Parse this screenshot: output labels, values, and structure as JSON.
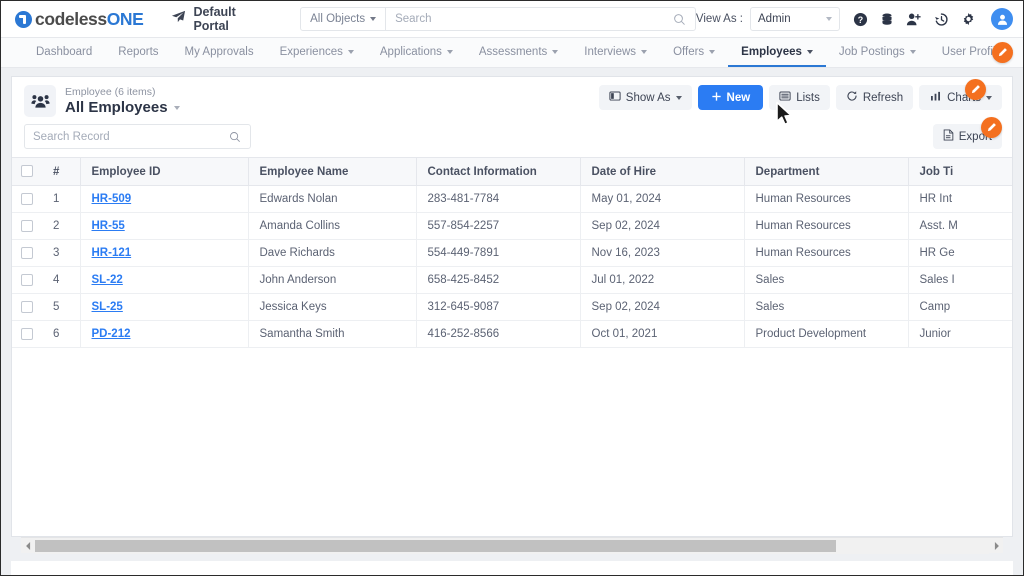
{
  "header": {
    "logo_text_a": "codeless",
    "logo_text_b": "ONE",
    "logo_icon": "circle-one-icon",
    "portal_icon": "paper-plane-icon",
    "portal_label": "Default Portal",
    "object_selector": "All Objects",
    "search_placeholder": "Search",
    "search_value": "",
    "search_icon": "search-icon",
    "view_as_label": "View As :",
    "view_as_value": "Admin",
    "icons": [
      {
        "name": "help-icon",
        "glyph": "?"
      },
      {
        "name": "database-icon",
        "glyph": "db"
      },
      {
        "name": "add-user-icon",
        "glyph": "user+"
      },
      {
        "name": "history-icon",
        "glyph": "clock"
      },
      {
        "name": "gear-icon",
        "glyph": "gear"
      },
      {
        "name": "avatar-icon",
        "glyph": "user"
      }
    ]
  },
  "nav": {
    "items": [
      {
        "label": "Dashboard",
        "caret": false,
        "active": false
      },
      {
        "label": "Reports",
        "caret": false,
        "active": false
      },
      {
        "label": "My Approvals",
        "caret": false,
        "active": false
      },
      {
        "label": "Experiences",
        "caret": true,
        "active": false
      },
      {
        "label": "Applications",
        "caret": true,
        "active": false
      },
      {
        "label": "Assessments",
        "caret": true,
        "active": false
      },
      {
        "label": "Interviews",
        "caret": true,
        "active": false
      },
      {
        "label": "Offers",
        "caret": true,
        "active": false
      },
      {
        "label": "Employees",
        "caret": true,
        "active": true
      },
      {
        "label": "Job Postings",
        "caret": true,
        "active": false
      },
      {
        "label": "User Profile",
        "caret": true,
        "active": false
      }
    ],
    "edit_badge_icon": "pencil-edit-icon"
  },
  "toolbar": {
    "entity_icon": "people-group-icon",
    "subtitle": "Employee (6 items)",
    "title": "All Employees",
    "show_as_label": "Show As",
    "show_as_icon": "panel-icon",
    "new_label": "New",
    "new_icon": "plus-icon",
    "lists_label": "Lists",
    "lists_icon": "list-icon",
    "refresh_label": "Refresh",
    "refresh_icon": "refresh-icon",
    "charts_label": "Charts",
    "charts_icon": "chart-icon",
    "export_label": "Export",
    "export_icon": "export-file-icon",
    "record_search_placeholder": "Search Record",
    "record_search_value": "",
    "record_search_icon": "search-icon"
  },
  "table": {
    "columns": [
      {
        "key": "num",
        "label": "#"
      },
      {
        "key": "id",
        "label": "Employee ID"
      },
      {
        "key": "name",
        "label": "Employee Name"
      },
      {
        "key": "cont",
        "label": "Contact Information"
      },
      {
        "key": "date",
        "label": "Date of Hire"
      },
      {
        "key": "dept",
        "label": "Department"
      },
      {
        "key": "job",
        "label": "Job Ti"
      }
    ],
    "row_action_icon": "ellipsis-icon",
    "rows": [
      {
        "num": "1",
        "id": "HR-509",
        "name": "Edwards Nolan",
        "cont": "283-481-7784",
        "date": "May 01, 2024",
        "dept": "Human Resources",
        "job": "HR Int"
      },
      {
        "num": "2",
        "id": "HR-55",
        "name": "Amanda Collins",
        "cont": "557-854-2257",
        "date": "Sep 02, 2024",
        "dept": "Human Resources",
        "job": "Asst. M"
      },
      {
        "num": "3",
        "id": "HR-121",
        "name": "Dave Richards",
        "cont": "554-449-7891",
        "date": "Nov 16, 2023",
        "dept": "Human Resources",
        "job": "HR Ge"
      },
      {
        "num": "4",
        "id": "SL-22",
        "name": "John Anderson",
        "cont": "658-425-8452",
        "date": "Jul 01, 2022",
        "dept": "Sales",
        "job": "Sales I"
      },
      {
        "num": "5",
        "id": "SL-25",
        "name": "Jessica Keys",
        "cont": "312-645-9087",
        "date": "Sep 02, 2024",
        "dept": "Sales",
        "job": "Camp"
      },
      {
        "num": "6",
        "id": "PD-212",
        "name": "Samantha Smith",
        "cont": "416-252-8566",
        "date": "Oct 01, 2021",
        "dept": "Product Development",
        "job": "Junior"
      }
    ]
  },
  "scrollbar": {
    "left_arrow_icon": "chevron-left-icon",
    "right_arrow_icon": "chevron-right-icon",
    "thumb_percent": 84
  },
  "colors": {
    "brand_blue": "#2b78d4",
    "primary_button": "#2b7cf3",
    "edit_badge_orange": "#f4701f",
    "link_blue": "#2b7cf3",
    "page_bg": "#eef0f3"
  }
}
